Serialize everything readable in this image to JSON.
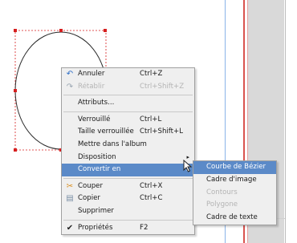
{
  "main_menu": {
    "items": [
      {
        "icon": "↶",
        "icon_color": "#2f6fc7",
        "label": "Annuler",
        "shortcut": "Ctrl+Z",
        "disabled": false
      },
      {
        "icon": "↷",
        "icon_color": "#9aa6b2",
        "label": "Rétablir",
        "shortcut": "Ctrl+Shift+Z",
        "disabled": true
      },
      {
        "sep": true
      },
      {
        "label": "Attributs...",
        "shortcut": "",
        "disabled": false
      },
      {
        "sep": true
      },
      {
        "label": "Verrouillé",
        "shortcut": "Ctrl+L",
        "disabled": false
      },
      {
        "label": "Taille verrouillée",
        "shortcut": "Ctrl+Shift+L",
        "disabled": false
      },
      {
        "label": "Mettre dans l'album",
        "shortcut": "",
        "disabled": false
      },
      {
        "label": "Disposition",
        "shortcut": "",
        "disabled": false,
        "submenu": true
      },
      {
        "label": "Convertir en",
        "shortcut": "",
        "disabled": false,
        "submenu": true,
        "active": true
      },
      {
        "sep": true
      },
      {
        "icon": "✂",
        "icon_color": "#d98c1a",
        "label": "Couper",
        "shortcut": "Ctrl+X",
        "disabled": false
      },
      {
        "icon": "▤",
        "icon_color": "#7a8fa6",
        "label": "Copier",
        "shortcut": "Ctrl+C",
        "disabled": false
      },
      {
        "label": "Supprimer",
        "shortcut": "",
        "disabled": false
      },
      {
        "sep": true
      },
      {
        "icon": "✔",
        "icon_color": "#222222",
        "label": "Propriétés",
        "shortcut": "F2",
        "disabled": false
      }
    ],
    "submenu_arrow": "▸"
  },
  "convert_submenu": {
    "items": [
      {
        "label": "Courbe de Bézier",
        "disabled": false,
        "active": true
      },
      {
        "label": "Cadre d'image",
        "disabled": false
      },
      {
        "label": "Contours",
        "disabled": true
      },
      {
        "label": "Polygone",
        "disabled": true
      },
      {
        "label": "Cadre de texte",
        "disabled": false
      }
    ]
  },
  "colors": {
    "menu_highlight": "#5b8ac8",
    "selection_handle": "#d61f1f",
    "guide_red": "#d9534f",
    "guide_blue": "#8ab4e8"
  },
  "icons": {
    "undo": "undo-icon",
    "redo": "redo-icon",
    "cut": "scissors-icon",
    "copy": "copy-icon",
    "check": "checkmark-icon",
    "submenu": "chevron-right-icon",
    "cursor": "mouse-pointer-icon"
  }
}
